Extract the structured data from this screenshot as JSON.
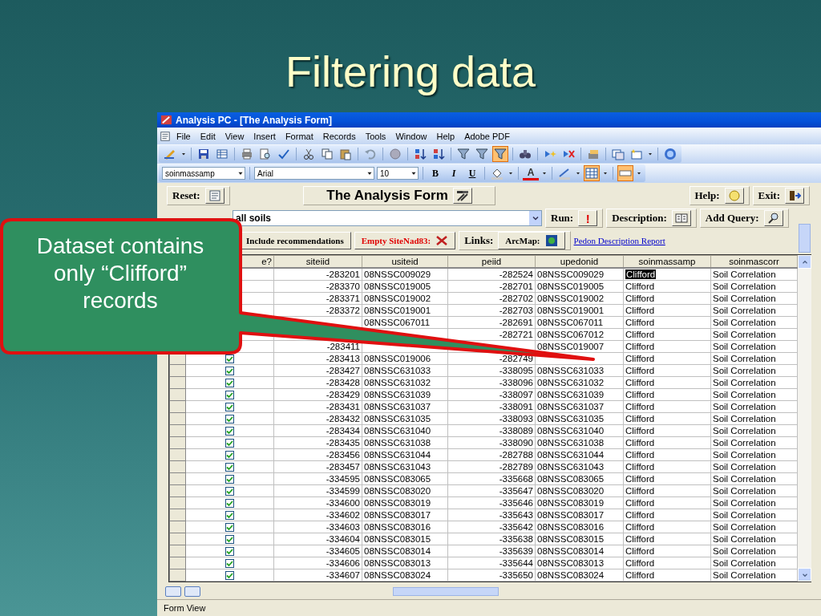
{
  "slide": {
    "title": "Filtering data"
  },
  "callout": {
    "text": "Dataset contains only “Clifford” records"
  },
  "window": {
    "title": "Analysis PC - [The Analysis Form]"
  },
  "menu": [
    "File",
    "Edit",
    "View",
    "Insert",
    "Format",
    "Records",
    "Tools",
    "Window",
    "Help",
    "Adobe PDF"
  ],
  "toolbar": {
    "filter_selected": true
  },
  "format_toolbar": {
    "object": "soinmassamp",
    "font": "Arial",
    "size": "10",
    "bold": "B",
    "italic": "I",
    "underline": "U",
    "font_color": "A",
    "gridlines_selected": true,
    "effect_selected": true
  },
  "form": {
    "reset_label": "Reset:",
    "heading": "The Analysis Form",
    "help_label": "Help:",
    "exit_label": "Exit:",
    "query_value": "all soils",
    "run_label": "Run:",
    "run_mark": "!",
    "description_label": "Description:",
    "add_query_label": "Add Query:",
    "include_button": "Include recommendations",
    "empty_button": "Empty SiteNad83:",
    "links_label": "Links:",
    "arcmap_button": "ArcMap:",
    "report_link": "Pedon Description Report"
  },
  "table": {
    "columns": [
      "e?",
      "siteiid",
      "usiteid",
      "peiid",
      "upedonid",
      "soinmassamp",
      "soinmascorr"
    ],
    "rows": [
      {
        "cells": [
          "",
          "-283201",
          "08NSSC009029",
          "-282524",
          "08NSSC009029",
          "Clifford",
          "Soil Correlation"
        ],
        "selected": true
      },
      {
        "cells": [
          "",
          "-283370",
          "08NSSC019005",
          "-282701",
          "08NSSC019005",
          "Clifford",
          "Soil Correlation"
        ],
        "selected": false
      },
      {
        "cells": [
          "",
          "-283371",
          "08NSSC019002",
          "-282702",
          "08NSSC019002",
          "Clifford",
          "Soil Correlation"
        ],
        "selected": false
      },
      {
        "cells": [
          "",
          "-283372",
          "08NSSC019001",
          "-282703",
          "08NSSC019001",
          "Clifford",
          "Soil Correlation"
        ],
        "selected": false
      },
      {
        "cells": [
          "",
          null,
          "08NSSC067011",
          "-282691",
          "08NSSC067011",
          "Clifford",
          "Soil Correlation"
        ],
        "selected": false
      },
      {
        "cells": [
          "",
          null,
          null,
          "-282721",
          "08NSSC067012",
          "Clifford",
          "Soil Correlation"
        ],
        "selected": false
      },
      {
        "cells": [
          "",
          "-283411",
          null,
          null,
          "08NSSC019007",
          "Clifford",
          "Soil Correlation"
        ],
        "selected": false
      },
      {
        "cells": [
          "",
          "-283413",
          "08NSSC019006",
          "-282749",
          null,
          "Clifford",
          "Soil Correlation"
        ],
        "checked": true,
        "selected": false
      },
      {
        "cells": [
          "",
          "-283427",
          "08NSSC631033",
          "-338095",
          "08NSSC631033",
          "Clifford",
          "Soil Correlation"
        ],
        "checked": true,
        "selected": false
      },
      {
        "cells": [
          "",
          "-283428",
          "08NSSC631032",
          "-338096",
          "08NSSC631032",
          "Clifford",
          "Soil Correlation"
        ],
        "checked": true,
        "selected": false
      },
      {
        "cells": [
          "",
          "-283429",
          "08NSSC631039",
          "-338097",
          "08NSSC631039",
          "Clifford",
          "Soil Correlation"
        ],
        "checked": true,
        "selected": false
      },
      {
        "cells": [
          "",
          "-283431",
          "08NSSC631037",
          "-338091",
          "08NSSC631037",
          "Clifford",
          "Soil Correlation"
        ],
        "checked": true,
        "selected": false
      },
      {
        "cells": [
          "",
          "-283432",
          "08NSSC631035",
          "-338093",
          "08NSSC631035",
          "Clifford",
          "Soil Correlation"
        ],
        "checked": true,
        "selected": false
      },
      {
        "cells": [
          "",
          "-283434",
          "08NSSC631040",
          "-338089",
          "08NSSC631040",
          "Clifford",
          "Soil Correlation"
        ],
        "checked": true,
        "selected": false
      },
      {
        "cells": [
          "",
          "-283435",
          "08NSSC631038",
          "-338090",
          "08NSSC631038",
          "Clifford",
          "Soil Correlation"
        ],
        "checked": true,
        "selected": false
      },
      {
        "cells": [
          "",
          "-283456",
          "08NSSC631044",
          "-282788",
          "08NSSC631044",
          "Clifford",
          "Soil Correlation"
        ],
        "checked": true,
        "selected": false
      },
      {
        "cells": [
          "",
          "-283457",
          "08NSSC631043",
          "-282789",
          "08NSSC631043",
          "Clifford",
          "Soil Correlation"
        ],
        "checked": true,
        "selected": false
      },
      {
        "cells": [
          "",
          "-334595",
          "08NSSC083065",
          "-335668",
          "08NSSC083065",
          "Clifford",
          "Soil Correlation"
        ],
        "checked": true,
        "selected": false
      },
      {
        "cells": [
          "",
          "-334599",
          "08NSSC083020",
          "-335647",
          "08NSSC083020",
          "Clifford",
          "Soil Correlation"
        ],
        "checked": true,
        "selected": false
      },
      {
        "cells": [
          "",
          "-334600",
          "08NSSC083019",
          "-335646",
          "08NSSC083019",
          "Clifford",
          "Soil Correlation"
        ],
        "checked": true,
        "selected": false
      },
      {
        "cells": [
          "",
          "-334602",
          "08NSSC083017",
          "-335643",
          "08NSSC083017",
          "Clifford",
          "Soil Correlation"
        ],
        "checked": true,
        "selected": false
      },
      {
        "cells": [
          "",
          "-334603",
          "08NSSC083016",
          "-335642",
          "08NSSC083016",
          "Clifford",
          "Soil Correlation"
        ],
        "checked": true,
        "selected": false
      },
      {
        "cells": [
          "",
          "-334604",
          "08NSSC083015",
          "-335638",
          "08NSSC083015",
          "Clifford",
          "Soil Correlation"
        ],
        "checked": true,
        "selected": false
      },
      {
        "cells": [
          "",
          "-334605",
          "08NSSC083014",
          "-335639",
          "08NSSC083014",
          "Clifford",
          "Soil Correlation"
        ],
        "checked": true,
        "selected": false
      },
      {
        "cells": [
          "",
          "-334606",
          "08NSSC083013",
          "-335644",
          "08NSSC083013",
          "Clifford",
          "Soil Correlation"
        ],
        "checked": true,
        "selected": false
      },
      {
        "cells": [
          "",
          "-334607",
          "08NSSC083024",
          "-335650",
          "08NSSC083024",
          "Clifford",
          "Soil Correlation"
        ],
        "checked": true,
        "selected": false
      }
    ]
  },
  "status_bar": "Form View"
}
